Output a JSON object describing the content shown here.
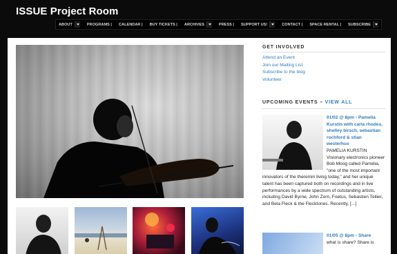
{
  "site": {
    "title": "ISSUE Project Room"
  },
  "nav": [
    {
      "label": "ABOUT",
      "dropdown": true
    },
    {
      "label": "PROGRAMS |",
      "dropdown": false
    },
    {
      "label": "CALENDAR |",
      "dropdown": false
    },
    {
      "label": "BUY TICKETS |",
      "dropdown": false
    },
    {
      "label": "ARCHIVES",
      "dropdown": true
    },
    {
      "label": "PRESS |",
      "dropdown": false
    },
    {
      "label": "SUPPORT US!",
      "dropdown": true
    },
    {
      "label": "CONTACT |",
      "dropdown": false
    },
    {
      "label": "SPACE RENTAL |",
      "dropdown": false
    },
    {
      "label": "SUBSCRIBE",
      "dropdown": true
    }
  ],
  "sidebar": {
    "get_involved": {
      "heading": "GET INVOLVED",
      "links": [
        "Attend an Event",
        "Join our Mailing List",
        "Subscribe to the blog",
        "Volunteer"
      ]
    },
    "upcoming": {
      "heading": "UPCOMING EVENTS –",
      "view_all": "VIEW ALL",
      "events": [
        {
          "title": "01/02 @ 8pm - Pamelia Kurstin with carla rhodes, shelley birsch, sebastian rochford & stian westerhus",
          "body": "PAMELIA KURSTIN Visionary electronics pioneer Bob Moog called Pamelia, \"one of the most important innovators of the theremin living today,\" and her unique talent has been captured both on recordings and in live performances by a wide spectrum of outstanding artists, including David Byrne, John Zorn, Foetus, Sebastien Tellier, and Bela Fleck & the Flecktones. Recently, [...]"
        },
        {
          "title": "01/05 @ 8pm - Share",
          "body": "what is share? Share is"
        }
      ]
    }
  },
  "colors": {
    "link": "#2f7bbf",
    "background": "#0b0b0b",
    "content_bg": "#ffffff"
  }
}
